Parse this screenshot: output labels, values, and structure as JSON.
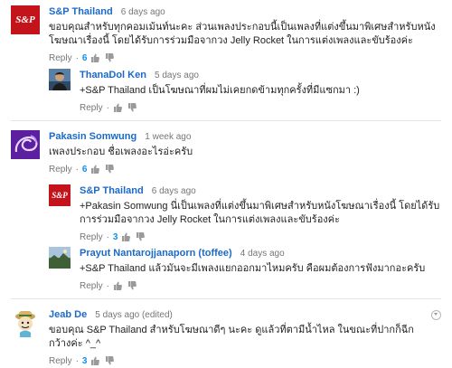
{
  "comments": [
    {
      "author": "S&P Thailand",
      "time": "6 days ago",
      "text": "ขอบคุณสำหรับทุกคอมเม้นท์นะคะ ส่วนเพลงประกอบนี้เป็นเพลงที่แต่งขึ้นมาพิเศษสำหรับหนังโฆษณาเรื่องนี้ โดยได้รับการร่วมมือจากวง Jelly Rocket ในการแต่งเพลงและขับร้องค่ะ",
      "reply_label": "Reply",
      "likes": "6",
      "avatar": "sp-logo-icon"
    },
    {
      "author": "ThanaDol Ken",
      "time": "5 days ago",
      "text": "+S&P Thailand เป็นโฆษณาที่ผมไม่เคยกดข้ามทุกครั้งที่มีแซกมา :)",
      "reply_label": "Reply",
      "likes": "",
      "avatar": "user-photo-icon"
    },
    {
      "author": "Pakasin Somwung",
      "time": "1 week ago",
      "text": "เพลงประกอบ ชื่อเพลงอะไรอ่ะครับ",
      "reply_label": "Reply",
      "likes": "6",
      "avatar": "purple-swirl-icon"
    },
    {
      "author": "S&P Thailand",
      "time": "6 days ago",
      "text": "+Pakasin Somwung นี่เป็นเพลงที่แต่งขึ้นมาพิเศษสำหรับหนังโฆษณาเรื่องนี้ โดยได้รับการร่วมมือจากวง Jelly Rocket ในการแต่งเพลงและขับร้องค่ะ",
      "reply_label": "Reply",
      "likes": "3",
      "avatar": "sp-logo-icon"
    },
    {
      "author": "Prayut Nantarojjanaporn (toffee)",
      "time": "4 days ago",
      "text": "+S&P Thailand แล้วมันจะมีเพลงแยกออกมาไหมครับ คือผมต้องการฟังมากอะครับ",
      "reply_label": "Reply",
      "likes": "",
      "avatar": "landscape-photo-icon"
    },
    {
      "author": "Jeab De",
      "time": "5 days ago (edited)",
      "text": "ขอบคุณ S&P Thailand สำหรับโฆษณาดีๆ นะคะ ดูแล้วที่ตามีน้ำไหล ในขณะที่ปากก็ฉีกกว้างค่ะ ^_^",
      "reply_label": "Reply",
      "likes": "3",
      "avatar": "cartoon-character-icon"
    }
  ],
  "colors": {
    "author_link": "#1b6ac9",
    "like_count": "#128ee9",
    "brand_red": "#c4141b"
  },
  "sp_logo_text": "S&P"
}
